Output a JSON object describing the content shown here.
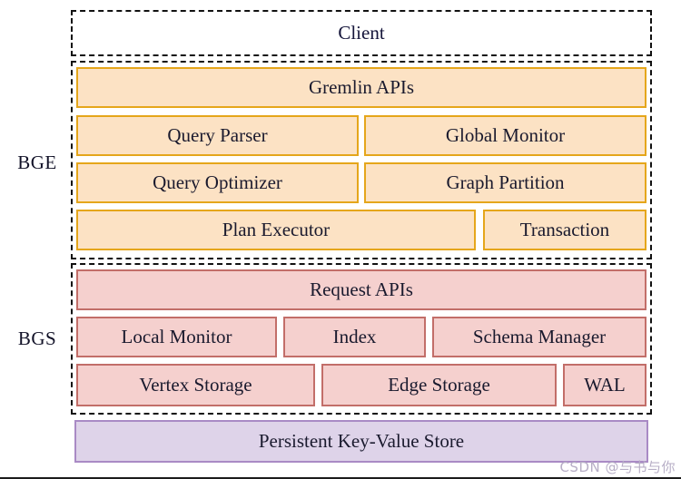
{
  "figure": {
    "tiers": [
      {
        "id": "bge",
        "label": "BGE"
      },
      {
        "id": "bgs",
        "label": "BGS"
      }
    ],
    "client": {
      "label": "Client"
    },
    "bge": {
      "rows": [
        {
          "boxes": [
            {
              "label": "Gremlin APIs"
            }
          ]
        },
        {
          "boxes": [
            {
              "label": "Query Parser"
            },
            {
              "label": "Global Monitor"
            }
          ]
        },
        {
          "boxes": [
            {
              "label": "Query Optimizer"
            },
            {
              "label": "Graph Partition"
            }
          ]
        },
        {
          "boxes": [
            {
              "label": "Plan Executor"
            },
            {
              "label": "Transaction"
            }
          ]
        }
      ]
    },
    "bgs": {
      "rows": [
        {
          "boxes": [
            {
              "label": "Request APIs"
            }
          ]
        },
        {
          "boxes": [
            {
              "label": "Local Monitor"
            },
            {
              "label": "Index"
            },
            {
              "label": "Schema Manager"
            }
          ]
        },
        {
          "boxes": [
            {
              "label": "Vertex Storage"
            },
            {
              "label": "Edge Storage"
            },
            {
              "label": "WAL"
            }
          ]
        }
      ]
    },
    "storage": {
      "label": "Persistent Key-Value Store"
    },
    "watermark": {
      "text": "CSDN @与书与你"
    },
    "colors": {
      "engine_fill": "#fce2c4",
      "engine_border": "#e5a61b",
      "store_fill": "#f5d0ce",
      "store_border": "#c26e69",
      "persistent_fill": "#ded3e9",
      "persistent_border": "#a98ac5",
      "group_border": "#111111",
      "text": "#15153a"
    }
  }
}
